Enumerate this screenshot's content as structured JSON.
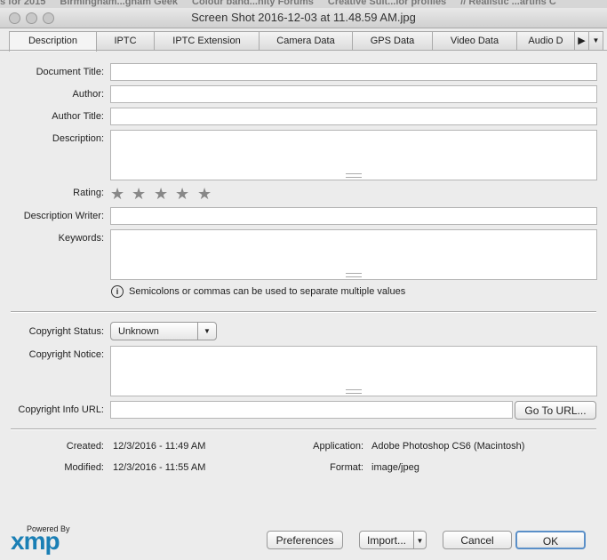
{
  "bookmarks": [
    "s for 2015",
    "Birmingham...gham Geek",
    "Colour band...nity Forums",
    "Creative Suit...lor profiles",
    "// Realistic ...artins C"
  ],
  "window": {
    "title": "Screen Shot 2016-12-03 at 11.48.59 AM.jpg"
  },
  "tabs": [
    "Description",
    "IPTC",
    "IPTC Extension",
    "Camera Data",
    "GPS Data",
    "Video Data",
    "Audio D"
  ],
  "fields": {
    "document_title": "Document Title:",
    "author": "Author:",
    "author_title": "Author Title:",
    "description": "Description:",
    "rating": "Rating:",
    "description_writer": "Description Writer:",
    "keywords": "Keywords:",
    "copyright_status": "Copyright Status:",
    "copyright_notice": "Copyright Notice:",
    "copyright_url": "Copyright Info URL:"
  },
  "rating": {
    "value": 0,
    "max": 5
  },
  "info_text": "Semicolons or commas can be used to separate multiple values",
  "copyright_status_value": "Unknown",
  "goto_url": "Go To URL...",
  "meta": {
    "created_label": "Created:",
    "created": "12/3/2016 - 11:49 AM",
    "modified_label": "Modified:",
    "modified": "12/3/2016 - 11:55 AM",
    "application_label": "Application:",
    "application": "Adobe Photoshop CS6 (Macintosh)",
    "format_label": "Format:",
    "format": "image/jpeg"
  },
  "logo": {
    "powered": "Powered By",
    "brand": "xmp",
    "color": "#1a7fb5"
  },
  "buttons": {
    "preferences": "Preferences",
    "import": "Import...",
    "cancel": "Cancel",
    "ok": "OK"
  }
}
